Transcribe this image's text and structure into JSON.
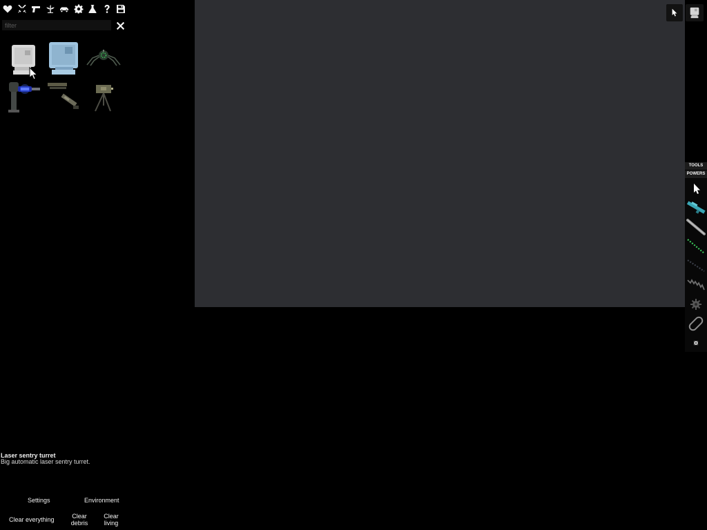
{
  "categories": [
    {
      "name": "heart-icon"
    },
    {
      "name": "crossed-swords-icon"
    },
    {
      "name": "pistol-icon"
    },
    {
      "name": "plant-icon"
    },
    {
      "name": "car-icon"
    },
    {
      "name": "gear-icon"
    },
    {
      "name": "flask-icon"
    },
    {
      "name": "question-icon"
    },
    {
      "name": "save-icon"
    }
  ],
  "filter": {
    "placeholder": "filter",
    "value": "",
    "clear_icon": "close-icon"
  },
  "items": [
    {
      "name": "item-grey-monitor-machine",
      "icon": "grey-monitor-icon"
    },
    {
      "name": "item-blue-monitor-machine",
      "icon": "blue-monitor-icon"
    },
    {
      "name": "item-spider-sentry",
      "icon": "spider-sentry-icon"
    },
    {
      "name": "item-laser-sentry-turret",
      "icon": "laser-turret-icon"
    },
    {
      "name": "item-rifle-parts",
      "icon": "rifle-parts-icon"
    },
    {
      "name": "item-tripod-turret",
      "icon": "tripod-turret-icon"
    }
  ],
  "selected_item": {
    "title": "Laser sentry turret",
    "description": "Big automatic laser sentry turret."
  },
  "bottom_menu": {
    "settings": "Settings",
    "environment": "Environment",
    "clear_everything": "Clear everything",
    "clear_debris": "Clear debris",
    "clear_living": "Clear living"
  },
  "toolbar": {
    "tabs": [
      "TOOLS",
      "POWERS"
    ],
    "tools": [
      "cursor-icon",
      "cyan-rifle-icon",
      "grey-rod-icon",
      "green-dotted-line-icon",
      "dark-dotted-line-icon",
      "zigzag-icon",
      "gear-cluster-icon",
      "chain-link-icon",
      "small-dot-icon"
    ]
  },
  "top_right_buttons": [
    "cursor-icon",
    "monitor-icon"
  ],
  "colors": {
    "background": "#000000",
    "viewport": "#2d2e32",
    "accent_cyan": "#3aa6b5",
    "accent_green": "#3cc95b",
    "laser_blue": "#3e66ff"
  }
}
